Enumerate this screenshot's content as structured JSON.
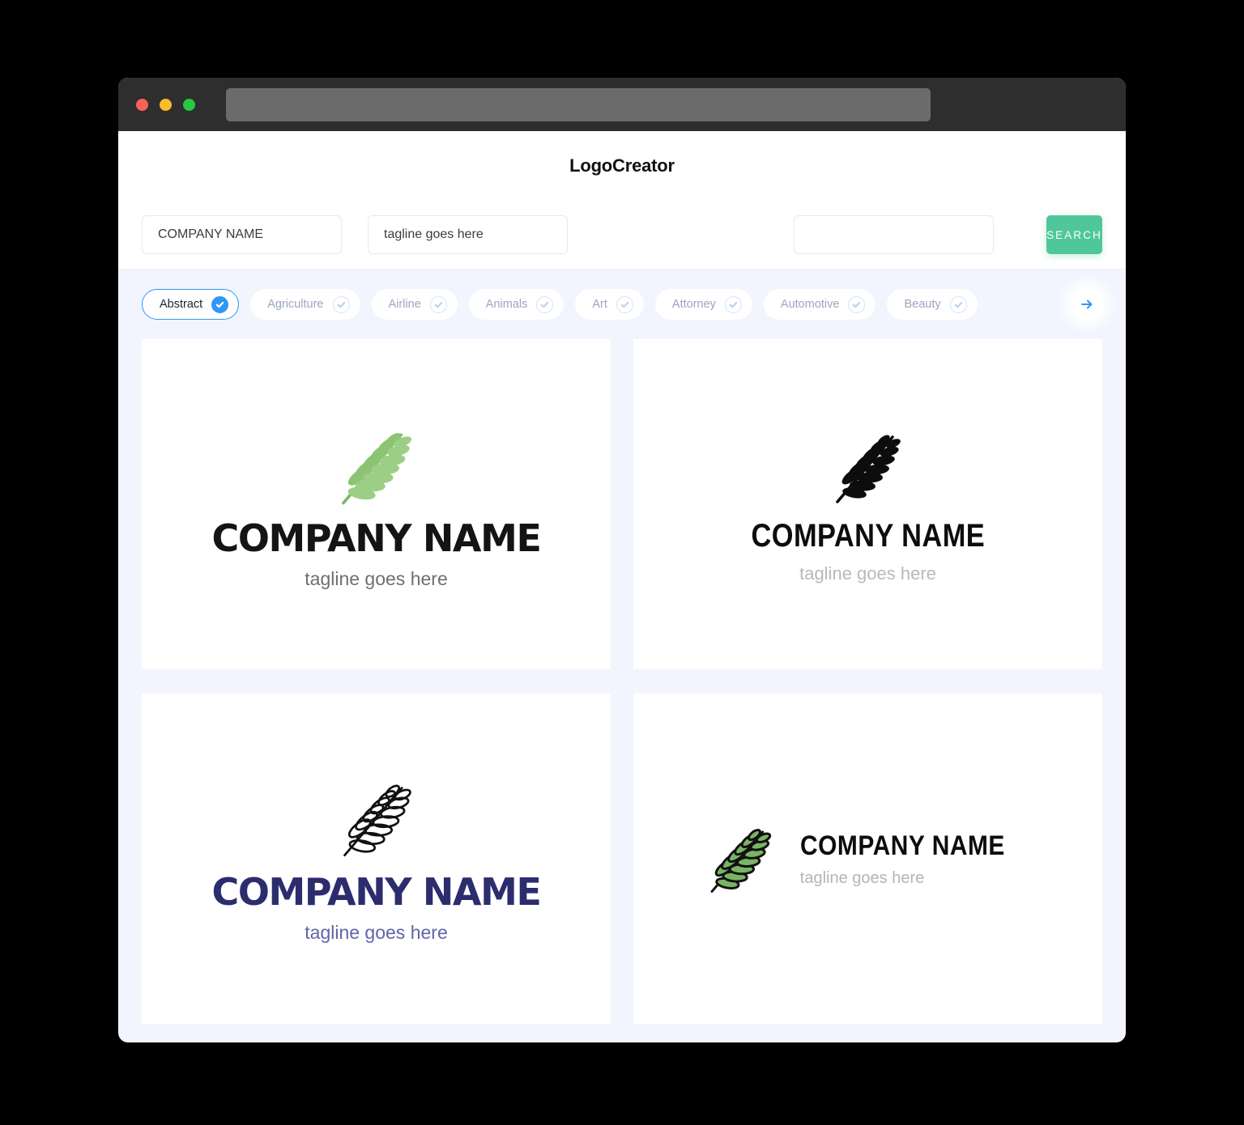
{
  "window": {
    "traffic_lights": [
      {
        "name": "close",
        "color": "#ff5f57"
      },
      {
        "name": "minimize",
        "color": "#fbbd2e"
      },
      {
        "name": "maximize",
        "color": "#28c840"
      }
    ],
    "url_value": ""
  },
  "header": {
    "brand": "LogoCreator"
  },
  "search": {
    "company_value": "COMPANY NAME",
    "company_placeholder": "COMPANY NAME",
    "tagline_value": "tagline goes here",
    "tagline_placeholder": "tagline goes here",
    "extra_value": "",
    "extra_placeholder": "",
    "button_label": "SEARCH",
    "button_color": "#50c79a"
  },
  "categories": {
    "accent_color": "#2f97f5",
    "next_icon": "arrow-right-icon",
    "items": [
      {
        "label": "Abstract",
        "selected": true
      },
      {
        "label": "Agriculture",
        "selected": false
      },
      {
        "label": "Airline",
        "selected": false
      },
      {
        "label": "Animals",
        "selected": false
      },
      {
        "label": "Art",
        "selected": false
      },
      {
        "label": "Attorney",
        "selected": false
      },
      {
        "label": "Automotive",
        "selected": false
      },
      {
        "label": "Beauty",
        "selected": false
      }
    ]
  },
  "results": [
    {
      "id": "logo-1",
      "layout": "stacked",
      "icon": "fern-leaf-icon",
      "icon_style": "filled-green",
      "name": "COMPANY NAME",
      "tagline": "tagline goes here",
      "name_color": "#141414",
      "tagline_color": "#6f6f6f",
      "icon_color": "#7cb867"
    },
    {
      "id": "logo-2",
      "layout": "stacked",
      "icon": "fern-leaf-icon",
      "icon_style": "filled-black",
      "name": "COMPANY NAME",
      "tagline": "tagline goes here",
      "name_color": "#0d0d0d",
      "tagline_color": "#b9b9b9",
      "icon_color": "#0d0d0d"
    },
    {
      "id": "logo-3",
      "layout": "stacked",
      "icon": "fern-leaf-icon",
      "icon_style": "outline-black",
      "name": "COMPANY NAME",
      "tagline": "tagline goes here",
      "name_color": "#2b2d6e",
      "tagline_color": "#6165a8",
      "icon_color": "#111111"
    },
    {
      "id": "logo-4",
      "layout": "horizontal",
      "icon": "fern-leaf-icon",
      "icon_style": "green-with-black-outline",
      "name": "COMPANY NAME",
      "tagline": "tagline goes here",
      "name_color": "#0d0d0d",
      "tagline_color": "#b5b5b5",
      "icon_color": "#79b464"
    }
  ]
}
